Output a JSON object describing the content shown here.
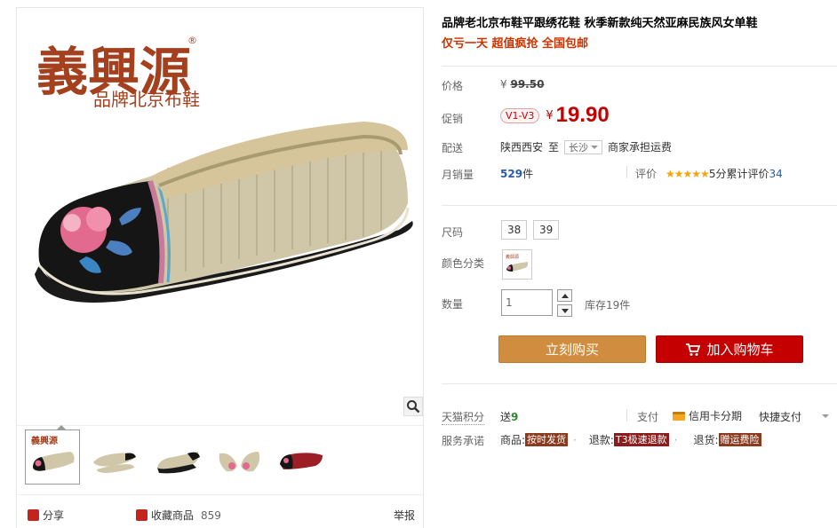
{
  "brand": {
    "logo_text": "義興源",
    "slogan": "品牌北京布鞋",
    "reg_mark": "®"
  },
  "product": {
    "title": "品牌老北京布鞋平跟绣花鞋 秋季新款纯天然亚麻民族风女单鞋",
    "subtitle": "仅亏一天 超值疯抢 全国包邮"
  },
  "price": {
    "label": "价格",
    "currency": "¥",
    "original": "99.50"
  },
  "promo": {
    "label": "促销",
    "badge": "V1-V3",
    "currency": "¥",
    "price": "19.90"
  },
  "shipping": {
    "label": "配送",
    "from": "陕西西安",
    "to_word": "至",
    "to_city": "长沙",
    "fee_note": "商家承担运费"
  },
  "sales": {
    "label": "月销量",
    "count": "529",
    "unit": "件",
    "rating_label": "评价",
    "stars": "★★★★★",
    "rating_text": "5分",
    "cumulative_label": "累计评价",
    "review_count": "34"
  },
  "options": {
    "size_label": "尺码",
    "sizes": [
      "38",
      "39"
    ],
    "color_label": "颜色分类",
    "qty_label": "数量",
    "qty_value": "1",
    "stock_text": "库存19件"
  },
  "buttons": {
    "buy_now": "立刻购买",
    "add_cart": "加入购物车"
  },
  "points": {
    "label": "天猫积分",
    "give": "送",
    "value": "9",
    "pay_label": "支付",
    "credit": "信用卡分期",
    "quick_pay": "快捷支付"
  },
  "service": {
    "label": "服务承诺",
    "goods_label": "商品:",
    "goods_tag": "按时发货",
    "refund_label": "退款:",
    "refund_tag": "T3极速退款",
    "return_label": "退货:",
    "return_tag": "赠运费险"
  },
  "social": {
    "share": "分享",
    "favorite": "收藏商品",
    "fav_count": "859",
    "report": "举报"
  },
  "colors": {
    "accent_red": "#c40000",
    "buy_orange": "#d18d3f",
    "logo_brown": "#a5401f"
  }
}
